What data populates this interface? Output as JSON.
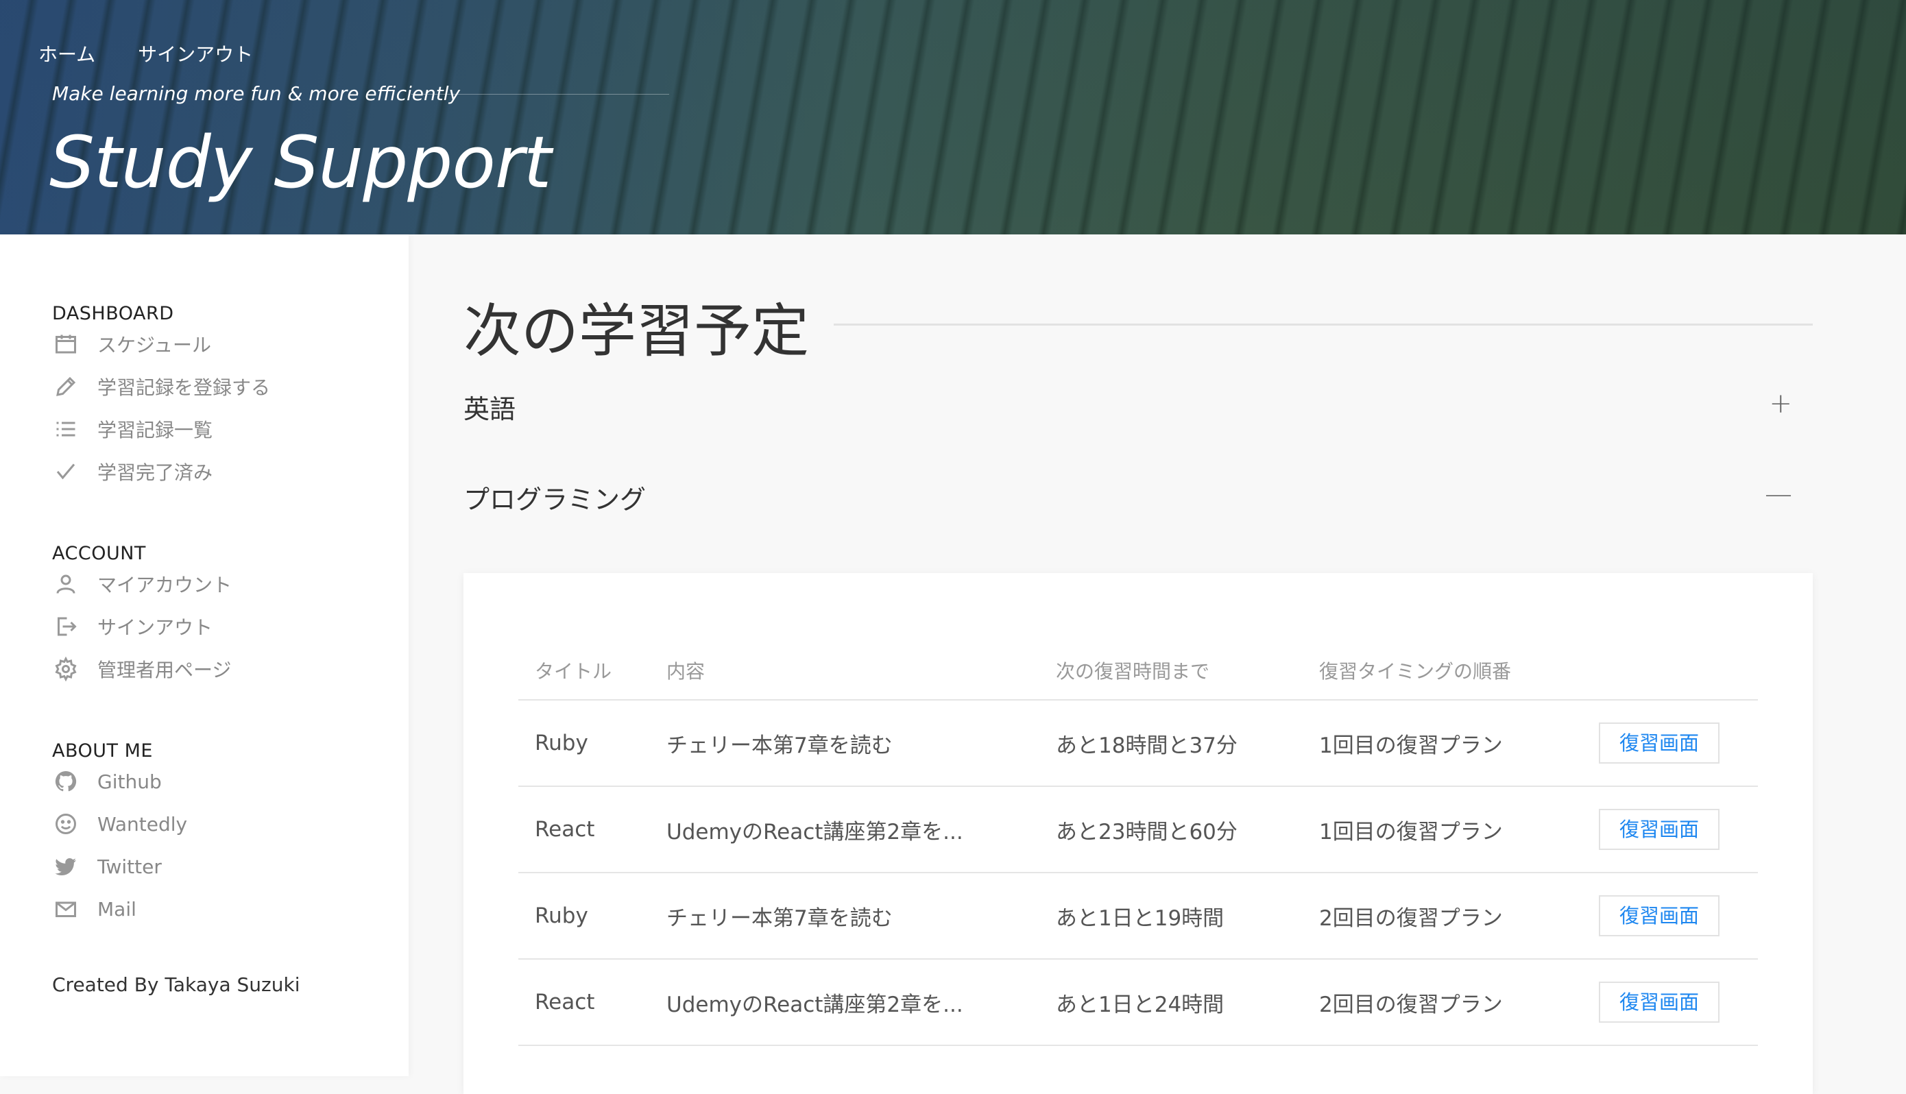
{
  "header": {
    "nav": [
      {
        "label": "ホーム"
      },
      {
        "label": "サインアウト"
      }
    ],
    "tagline": "Make learning more fun & more efficiently",
    "brand": "Study Support"
  },
  "sidebar": {
    "sections": [
      {
        "title": "DASHBOARD",
        "items": [
          {
            "label": "スケジュール",
            "icon": "calendar-icon"
          },
          {
            "label": "学習記録を登録する",
            "icon": "pencil-icon"
          },
          {
            "label": "学習記録一覧",
            "icon": "list-icon"
          },
          {
            "label": "学習完了済み",
            "icon": "check-icon"
          }
        ]
      },
      {
        "title": "ACCOUNT",
        "items": [
          {
            "label": "マイアカウント",
            "icon": "user-icon"
          },
          {
            "label": "サインアウト",
            "icon": "sign-out-icon"
          },
          {
            "label": "管理者用ページ",
            "icon": "gear-icon"
          }
        ]
      },
      {
        "title": "ABOUT ME",
        "items": [
          {
            "label": "Github",
            "icon": "github-icon"
          },
          {
            "label": "Wantedly",
            "icon": "smiley-icon"
          },
          {
            "label": "Twitter",
            "icon": "twitter-icon"
          },
          {
            "label": "Mail",
            "icon": "mail-icon"
          }
        ]
      }
    ],
    "credit": "Created By Takaya Suzuki"
  },
  "main": {
    "title": "次の学習予定",
    "accordions": [
      {
        "label": "英語",
        "sign": "+"
      },
      {
        "label": "プログラミング",
        "sign": "—"
      }
    ],
    "table": {
      "headers": [
        "タイトル",
        "内容",
        "次の復習時間まで",
        "復習タイミングの順番",
        ""
      ],
      "rows": [
        {
          "title": "Ruby",
          "content": "チェリー本第7章を読む",
          "next": "あと18時間と37分",
          "order": "1回目の復習プラン",
          "button": "復習画面"
        },
        {
          "title": "React",
          "content": "UdemyのReact講座第2章を...",
          "next": "あと23時間と60分",
          "order": "1回目の復習プラン",
          "button": "復習画面"
        },
        {
          "title": "Ruby",
          "content": "チェリー本第7章を読む",
          "next": "あと1日と19時間",
          "order": "2回目の復習プラン",
          "button": "復習画面"
        },
        {
          "title": "React",
          "content": "UdemyのReact講座第2章を...",
          "next": "あと1日と24時間",
          "order": "2回目の復習プラン",
          "button": "復習画面"
        }
      ]
    }
  },
  "colors": {
    "accent": "#1e87f0",
    "header_blue": "#2d4f78",
    "header_green": "#3c5a48"
  }
}
